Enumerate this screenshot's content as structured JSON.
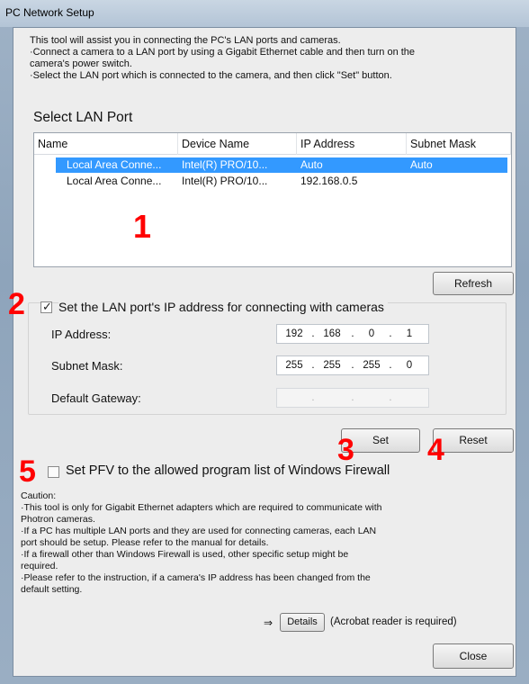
{
  "window": {
    "title": "PC Network Setup"
  },
  "intro": {
    "line1": "This tool will assist you in connecting the PC's LAN ports and cameras.",
    "line2": "·Connect a camera to a LAN port by using a Gigabit Ethernet cable and then turn on the",
    "line3": "camera's power switch.",
    "line4": "·Select the LAN port which is connected to the camera, and then click \"Set\" button."
  },
  "select_lan": {
    "title": "Select LAN Port",
    "columns": [
      "Name",
      "Device Name",
      "IP Address",
      "Subnet Mask"
    ],
    "rows": [
      {
        "name": "Local Area Conne...",
        "device": "Intel(R) PRO/10...",
        "ip": "Auto",
        "mask": "Auto",
        "selected": true
      },
      {
        "name": "Local Area Conne...",
        "device": "Intel(R) PRO/10...",
        "ip": "192.168.0.5",
        "mask": "",
        "selected": false
      }
    ]
  },
  "buttons": {
    "refresh": "Refresh",
    "set": "Set",
    "reset": "Reset",
    "details": "Details",
    "close": "Close"
  },
  "ip_settings": {
    "checkbox_label": "Set the LAN port's IP address for connecting with cameras",
    "checked": true,
    "ip_label": "IP Address:",
    "ip_octets": [
      "192",
      "168",
      "0",
      "1"
    ],
    "subnet_label": "Subnet Mask:",
    "subnet_octets": [
      "255",
      "255",
      "255",
      "0"
    ],
    "gateway_label": "Default Gateway:",
    "gateway_octets": [
      "",
      "",
      "",
      ""
    ]
  },
  "firewall": {
    "checkbox_label": "Set PFV to the allowed program list of Windows Firewall",
    "checked": false
  },
  "caution": {
    "heading": "Caution:",
    "line1": "·This tool is only for Gigabit Ethernet adapters which are required to communicate with",
    "line2": "Photron cameras.",
    "line3": "·If a PC has multiple LAN ports and they are used for connecting cameras, each LAN",
    "line4": "port should be setup. Please refer to the manual for details.",
    "line5": "·If a firewall other than Windows Firewall is used, other specific setup might be",
    "line6": "required.",
    "line7": "·Please refer to the instruction, if a camera's IP address has been changed from the",
    "line8": "default setting.",
    "arrow": "⇒",
    "details_note": "(Acrobat reader is required)"
  },
  "annotations": {
    "n1": "1",
    "n2": "2",
    "n3": "3",
    "n4": "4",
    "n5": "5"
  },
  "colors": {
    "selection": "#3399ff",
    "annotation": "#ff0000"
  }
}
